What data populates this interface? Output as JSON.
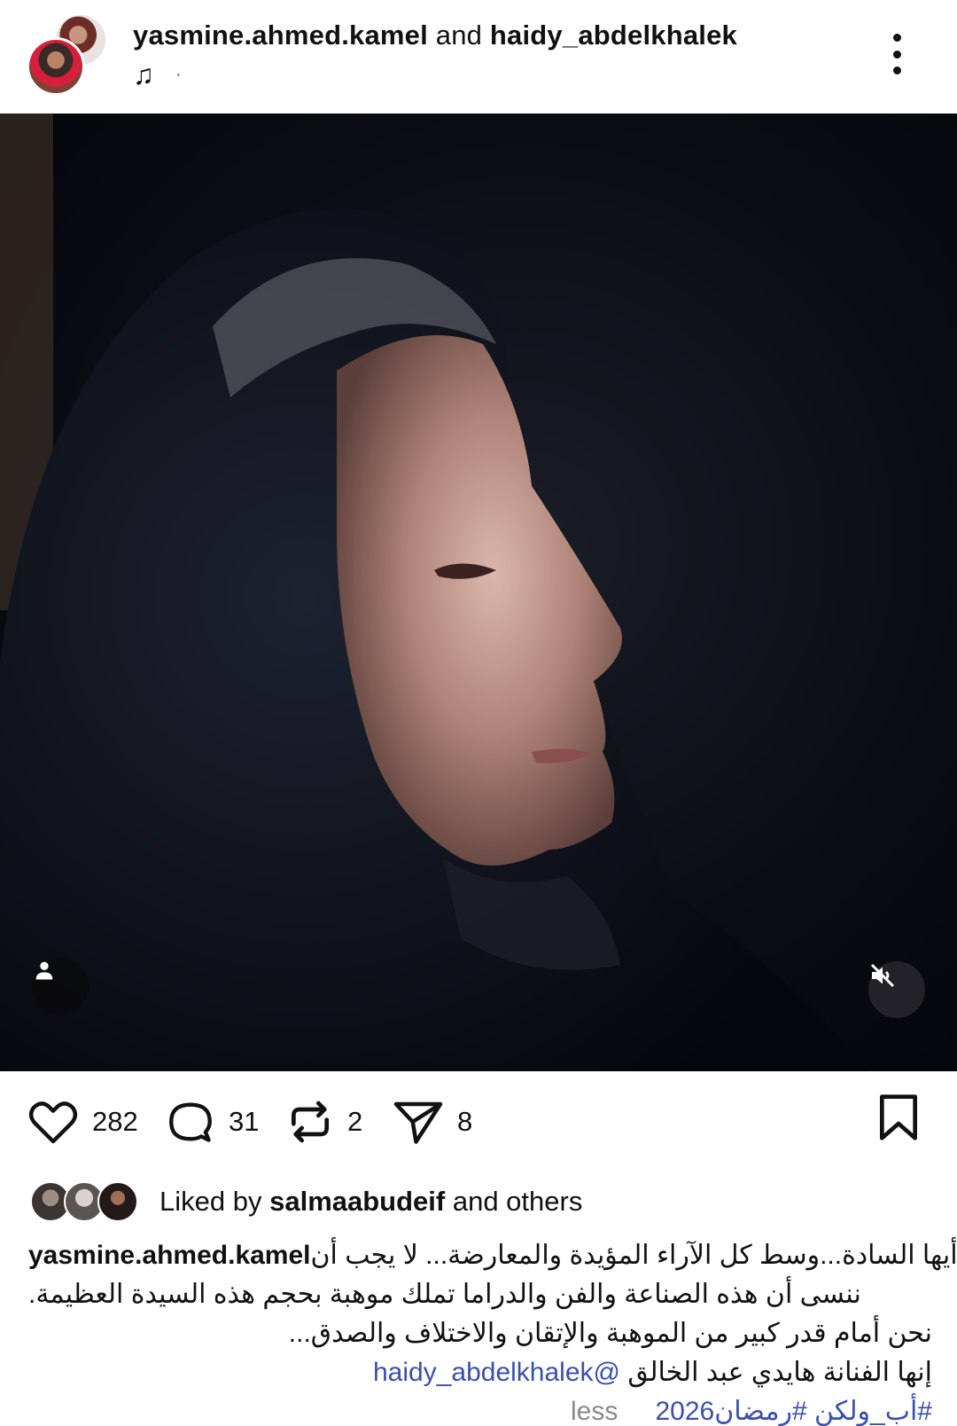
{
  "header": {
    "user1": "yasmine.ahmed.kamel",
    "connector": "and",
    "user2": "haidy_abdelkhalek",
    "music_icon": "music-note-icon",
    "music_separator": "·"
  },
  "media": {
    "tag_icon": "person-tag-icon",
    "mute_icon": "muted-speaker-icon"
  },
  "actions": {
    "likes": "282",
    "comments": "31",
    "reposts": "2",
    "shares": "8"
  },
  "liked_by": {
    "prefix": "Liked by",
    "user": "salmaabudeif",
    "suffix": "and others"
  },
  "caption": {
    "username": "yasmine.ahmed.kamel",
    "line1": "أيها السادة...وسط كل الآراء المؤيدة والمعارضة... لا يجب أن",
    "line2": ".ننسى أن هذه الصناعة والفن والدراما تملك موهبة بحجم هذه السيدة العظيمة",
    "line3": "نحن أمام قدر كبير من الموهبة والإتقان والاختلاف والصدق...",
    "line4_text": "إنها الفنانة هايدي عبد الخالق",
    "line4_mention": "haidy_abdelkhalek",
    "line4_mention_icon": "threads-at-icon",
    "tags": "#أب_ولكن  #رمضان2026",
    "less": "less"
  },
  "colors": {
    "link": "#3a4fb0",
    "muted": "#8a8a8a",
    "text": "#111111"
  }
}
